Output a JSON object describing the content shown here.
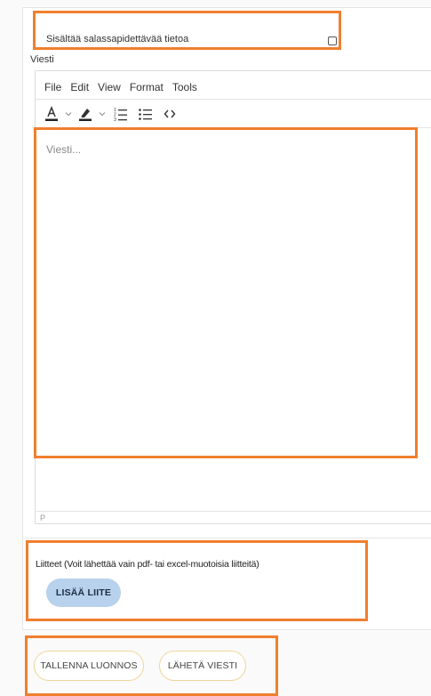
{
  "form": {
    "confidential_label": "Sisältää salassapidettävää tietoa",
    "message_label": "Viesti"
  },
  "editor": {
    "menu": [
      "File",
      "Edit",
      "View",
      "Format",
      "Tools"
    ],
    "placeholder": "Viesti...",
    "status_path": "P",
    "toolbar_icons": [
      "text-color-icon",
      "chevron-down-icon",
      "highlight-color-icon",
      "chevron-down-icon",
      "numbered-list-icon",
      "bulleted-list-icon",
      "source-code-icon"
    ]
  },
  "attachments": {
    "label": "Liitteet (Voit lähettää vain pdf- tai excel-muotoisia liitteitä)",
    "add_button": "LISÄÄ LIITE"
  },
  "actions": {
    "save_draft": "TALLENNA LUONNOS",
    "send_message": "LÄHETÄ VIESTI"
  },
  "colors": {
    "highlight": "#f07f2e",
    "add_button_bg": "#b8d1ec",
    "outline_button_border": "#f0d59a"
  }
}
